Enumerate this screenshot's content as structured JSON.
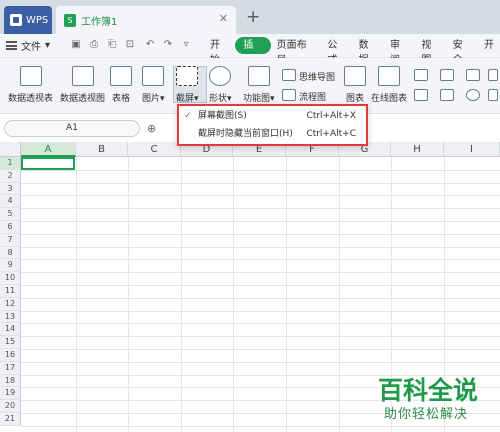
{
  "tabs": {
    "wps_label": "WPS",
    "doc_label": "工作簿1",
    "close_glyph": "✕",
    "add_glyph": "+"
  },
  "menubar": {
    "file_label": "文件",
    "items": [
      "开始",
      "插入",
      "页面布局",
      "公式",
      "数据",
      "审阅",
      "视图",
      "安全",
      "开"
    ],
    "active_index": 1
  },
  "ribbon": {
    "buttons": [
      "数据透视表",
      "数据透视图",
      "表格",
      "图片",
      "截屏",
      "形状",
      "功能图",
      "图表",
      "在线图表"
    ],
    "small_buttons": [
      "思维导图",
      "流程图"
    ]
  },
  "formula_bar": {
    "cell_ref": "A1",
    "fx_glyph": "⊕"
  },
  "grid": {
    "columns": [
      "A",
      "B",
      "C",
      "D",
      "E",
      "F",
      "G",
      "H",
      "I"
    ],
    "rows": [
      "1",
      "2",
      "3",
      "4",
      "5",
      "6",
      "7",
      "8",
      "9",
      "10",
      "11",
      "12",
      "13",
      "14",
      "15",
      "16",
      "17",
      "18",
      "19",
      "20",
      "21"
    ],
    "selected_cell": "A1"
  },
  "screenshot_menu": {
    "items": [
      {
        "check": "✓",
        "label": "屏幕截图(S)",
        "shortcut": "Ctrl+Alt+X"
      },
      {
        "check": "",
        "label": "截屏时隐藏当前窗口(H)",
        "shortcut": "Ctrl+Alt+C"
      }
    ]
  },
  "watermark": {
    "title": "百科全说",
    "subtitle": "助你轻松解决"
  },
  "colors": {
    "accent": "#1fa055",
    "highlight_border": "#e03a3a",
    "tab_blue": "#3a5fa5"
  }
}
